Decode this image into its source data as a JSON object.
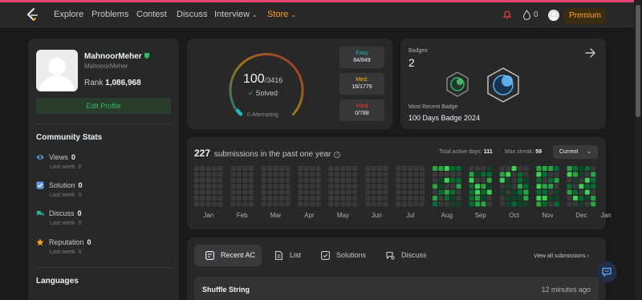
{
  "nav": {
    "links": [
      "Explore",
      "Problems",
      "Contest",
      "Discuss",
      "Interview",
      "Store"
    ],
    "streak": "0",
    "premium": "Premium"
  },
  "profile": {
    "username": "MahnoorMeher",
    "handle": "MahnoorMeher",
    "rank_label": "Rank",
    "rank_value": "1,086,968",
    "edit_button": "Edit Profile"
  },
  "community": {
    "title": "Community Stats",
    "sub_label": "Last week",
    "items": [
      {
        "label": "Views",
        "value": "0",
        "week": "0",
        "icon": "eye-icon",
        "color": "#5d9de8"
      },
      {
        "label": "Solution",
        "value": "0",
        "week": "0",
        "icon": "solution-checkbox-icon",
        "color": "#5d9de8"
      },
      {
        "label": "Discuss",
        "value": "0",
        "week": "0",
        "icon": "discuss-icon",
        "color": "#2bb3a3"
      },
      {
        "label": "Reputation",
        "value": "0",
        "week": "0",
        "icon": "star-icon",
        "color": "#ffa116"
      }
    ]
  },
  "languages": {
    "title": "Languages"
  },
  "solved": {
    "count": "100",
    "total": "/3416",
    "label": "Solved",
    "attempting": "0 Attempting",
    "progress_fraction": 0.0293,
    "difficulties": [
      {
        "name": "Easy",
        "value": "84/849",
        "color": "#1cbaba"
      },
      {
        "name": "Med.",
        "value": "16/1779",
        "color": "#ffb700"
      },
      {
        "name": "Hard",
        "value": "0/788",
        "color": "#f63737"
      }
    ]
  },
  "badges": {
    "title": "Badges",
    "count": "2",
    "recent_label": "Most Recent Badge",
    "recent_name": "100 Days Badge 2024"
  },
  "submissions": {
    "count": "227",
    "text": "submissions in the past one year",
    "active_label": "Total active days:",
    "active_value": "111",
    "streak_label": "Max streak:",
    "streak_value": "59",
    "selector": "Current",
    "months": [
      "Jan",
      "Feb",
      "Mar",
      "Apr",
      "May",
      "Jun",
      "Jul",
      "Aug",
      "Sep",
      "Oct",
      "Nov",
      "Dec",
      "Jan"
    ]
  },
  "recent": {
    "tabs": [
      {
        "label": "Recent AC",
        "icon": "recent-ac-icon"
      },
      {
        "label": "List",
        "icon": "list-icon"
      },
      {
        "label": "Solutions",
        "icon": "solutions-icon"
      },
      {
        "label": "Discuss",
        "icon": "discuss-icon"
      }
    ],
    "view_all": "View all submissions",
    "items": [
      {
        "title": "Shuffle String",
        "time": "12 minutes ago"
      }
    ]
  },
  "colors": {
    "accent": "#ffa116",
    "green": "#2cbb5d",
    "heat_empty": "#3a3a3a",
    "heat_levels": [
      "#0e4429",
      "#006d32",
      "#26a641",
      "#39d353"
    ]
  }
}
